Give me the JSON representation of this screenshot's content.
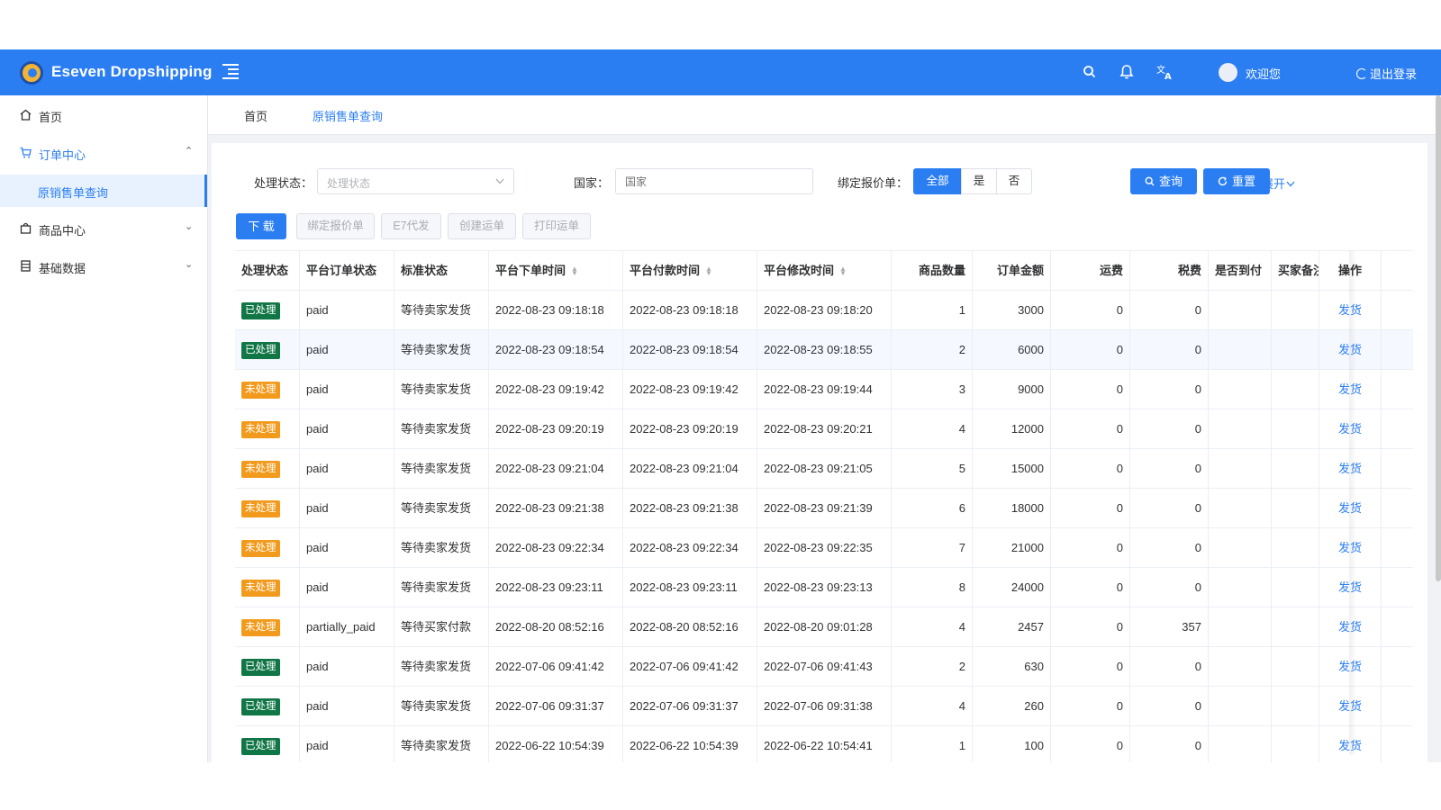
{
  "app": {
    "title": "Eseven Dropshipping",
    "brand_color": "#2b7ef2"
  },
  "header": {
    "icons": [
      "search-icon",
      "bell-icon",
      "translate-icon"
    ],
    "welcome": "欢迎您",
    "logout": "退出登录"
  },
  "sidebar": {
    "items": [
      {
        "label": "首页",
        "icon": "home-icon"
      },
      {
        "label": "订单中心",
        "icon": "cart-icon",
        "arrow": "⌃"
      },
      {
        "label": "原销售单查询"
      },
      {
        "label": "商品中心",
        "icon": "bag-icon",
        "arrow": "⌄"
      },
      {
        "label": "基础数据",
        "icon": "database-icon",
        "arrow": "⌄"
      }
    ]
  },
  "tabs": [
    {
      "label": "首页"
    },
    {
      "label": "原销售单查询"
    }
  ],
  "filters": {
    "status_label": "处理状态：",
    "status_placeholder": "处理状态",
    "country_label": "国家：",
    "country_placeholder": "国家",
    "bind_label": "绑定报价单：",
    "bind_options": [
      "全部",
      "是",
      "否"
    ],
    "bind_selected": "全部",
    "query": "查询",
    "reset": "重置",
    "expand": "展开"
  },
  "toolbar": {
    "download": "下 载",
    "bind_quote": "绑定报价单",
    "e7": "E7代发",
    "create_waybill": "创建运单",
    "print_waybill": "打印运单"
  },
  "table": {
    "headers": [
      "处理状态",
      "平台订单状态",
      "标准状态",
      "平台下单时间",
      "平台付款时间",
      "平台修改时间",
      "商品数量",
      "订单金额",
      "运费",
      "税费",
      "是否到付",
      "买家备注",
      "操作"
    ],
    "rows": [
      {
        "status": "已处理",
        "platform_status": "paid",
        "std_status": "等待卖家发货",
        "order_time": "2022-08-23 09:18:18",
        "pay_time": "2022-08-23 09:18:18",
        "modify_time": "2022-08-23 09:18:20",
        "qty": "1",
        "amount": "3000",
        "shipping": "0",
        "tax": "0",
        "action": "发货"
      },
      {
        "status": "已处理",
        "platform_status": "paid",
        "std_status": "等待卖家发货",
        "order_time": "2022-08-23 09:18:54",
        "pay_time": "2022-08-23 09:18:54",
        "modify_time": "2022-08-23 09:18:55",
        "qty": "2",
        "amount": "6000",
        "shipping": "0",
        "tax": "0",
        "action": "发货"
      },
      {
        "status": "未处理",
        "platform_status": "paid",
        "std_status": "等待卖家发货",
        "order_time": "2022-08-23 09:19:42",
        "pay_time": "2022-08-23 09:19:42",
        "modify_time": "2022-08-23 09:19:44",
        "qty": "3",
        "amount": "9000",
        "shipping": "0",
        "tax": "0",
        "action": "发货"
      },
      {
        "status": "未处理",
        "platform_status": "paid",
        "std_status": "等待卖家发货",
        "order_time": "2022-08-23 09:20:19",
        "pay_time": "2022-08-23 09:20:19",
        "modify_time": "2022-08-23 09:20:21",
        "qty": "4",
        "amount": "12000",
        "shipping": "0",
        "tax": "0",
        "action": "发货"
      },
      {
        "status": "未处理",
        "platform_status": "paid",
        "std_status": "等待卖家发货",
        "order_time": "2022-08-23 09:21:04",
        "pay_time": "2022-08-23 09:21:04",
        "modify_time": "2022-08-23 09:21:05",
        "qty": "5",
        "amount": "15000",
        "shipping": "0",
        "tax": "0",
        "action": "发货"
      },
      {
        "status": "未处理",
        "platform_status": "paid",
        "std_status": "等待卖家发货",
        "order_time": "2022-08-23 09:21:38",
        "pay_time": "2022-08-23 09:21:38",
        "modify_time": "2022-08-23 09:21:39",
        "qty": "6",
        "amount": "18000",
        "shipping": "0",
        "tax": "0",
        "action": "发货"
      },
      {
        "status": "未处理",
        "platform_status": "paid",
        "std_status": "等待卖家发货",
        "order_time": "2022-08-23 09:22:34",
        "pay_time": "2022-08-23 09:22:34",
        "modify_time": "2022-08-23 09:22:35",
        "qty": "7",
        "amount": "21000",
        "shipping": "0",
        "tax": "0",
        "action": "发货"
      },
      {
        "status": "未处理",
        "platform_status": "paid",
        "std_status": "等待卖家发货",
        "order_time": "2022-08-23 09:23:11",
        "pay_time": "2022-08-23 09:23:11",
        "modify_time": "2022-08-23 09:23:13",
        "qty": "8",
        "amount": "24000",
        "shipping": "0",
        "tax": "0",
        "action": "发货"
      },
      {
        "status": "未处理",
        "platform_status": "partially_paid",
        "std_status": "等待买家付款",
        "order_time": "2022-08-20 08:52:16",
        "pay_time": "2022-08-20 08:52:16",
        "modify_time": "2022-08-20 09:01:28",
        "qty": "4",
        "amount": "2457",
        "shipping": "0",
        "tax": "357",
        "action": "发货"
      },
      {
        "status": "已处理",
        "platform_status": "paid",
        "std_status": "等待卖家发货",
        "order_time": "2022-07-06 09:41:42",
        "pay_time": "2022-07-06 09:41:42",
        "modify_time": "2022-07-06 09:41:43",
        "qty": "2",
        "amount": "630",
        "shipping": "0",
        "tax": "0",
        "action": "发货"
      },
      {
        "status": "已处理",
        "platform_status": "paid",
        "std_status": "等待卖家发货",
        "order_time": "2022-07-06 09:31:37",
        "pay_time": "2022-07-06 09:31:37",
        "modify_time": "2022-07-06 09:31:38",
        "qty": "4",
        "amount": "260",
        "shipping": "0",
        "tax": "0",
        "action": "发货"
      },
      {
        "status": "已处理",
        "platform_status": "paid",
        "std_status": "等待卖家发货",
        "order_time": "2022-06-22 10:54:39",
        "pay_time": "2022-06-22 10:54:39",
        "modify_time": "2022-06-22 10:54:41",
        "qty": "1",
        "amount": "100",
        "shipping": "0",
        "tax": "0",
        "action": "发货"
      }
    ]
  }
}
